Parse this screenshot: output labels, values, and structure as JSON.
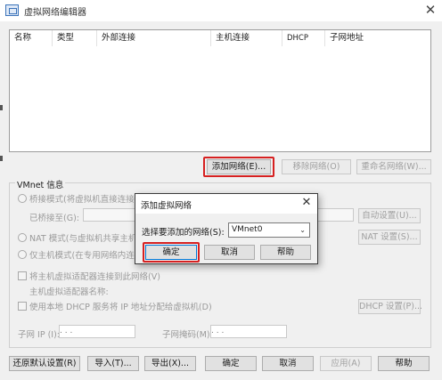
{
  "window": {
    "title": "虚拟网络编辑器",
    "close_glyph": "✕"
  },
  "table": {
    "columns": [
      "名称",
      "类型",
      "外部连接",
      "主机连接",
      "DHCP",
      "子网地址"
    ],
    "rows": []
  },
  "table_buttons": {
    "add_network": "添加网络(E)...",
    "remove_network": "移除网络(O)",
    "rename_network": "重命名网络(W)..."
  },
  "vmnet_info": {
    "legend": "VMnet 信息",
    "bridged_label": "桥接模式(将虚拟机直接连接",
    "bridged_to_label": "已桥接至(G):",
    "auto_settings": "自动设置(U)...",
    "nat_label": "NAT 模式(与虚拟机共享主机",
    "nat_settings": "NAT 设置(S)...",
    "hostonly_label": "仅主机模式(在专用网络内连",
    "connect_adapter_label": "将主机虚拟适配器连接到此网络(V)",
    "adapter_name_label": "主机虚拟适配器名称:",
    "dhcp_label": "使用本地 DHCP 服务将 IP 地址分配给虚拟机(D)",
    "dhcp_settings": "DHCP 设置(P)...",
    "subnet_ip_label": "子网 IP (I):",
    "subnet_mask_label": "子网掩码(M):",
    "ip_placeholder": " .  .  .",
    "mask_placeholder": " .  .  ."
  },
  "footer": {
    "restore_defaults": "还原默认设置(R)",
    "import": "导入(T)...",
    "export": "导出(X)...",
    "ok": "确定",
    "cancel": "取消",
    "apply": "应用(A)",
    "help": "帮助"
  },
  "dialog": {
    "title": "添加虚拟网络",
    "close_glyph": "✕",
    "select_label": "选择要添加的网络(S):",
    "selected_value": "VMnet0",
    "dropdown_glyph": "⌄",
    "ok": "确定",
    "cancel": "取消",
    "help": "帮助"
  },
  "colors": {
    "highlight_box": "#d62020",
    "focus_border": "#0078d7"
  }
}
